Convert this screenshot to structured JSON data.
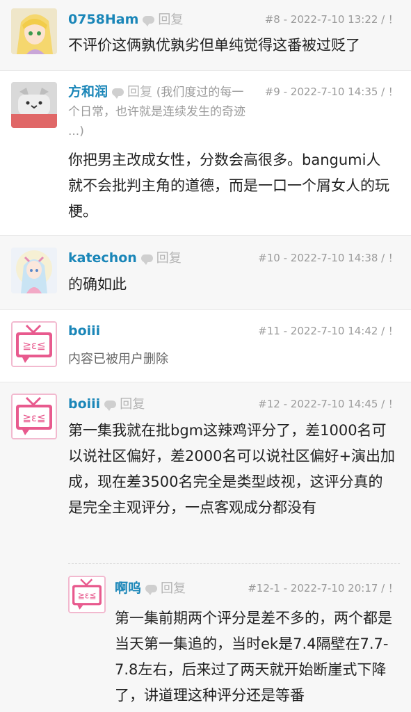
{
  "posts": [
    {
      "username": "0758Ham",
      "reply": "回复",
      "floor": "#8 - 2022-7-10 13:22 / ！",
      "text": "不评价这俩孰优孰劣但单纯觉得这番被过贬了"
    },
    {
      "username": "方和润",
      "reply": "回复",
      "sign_line1": "(我们度过的每一",
      "sign_line2": "个日常，也许就是连续发生的奇迹",
      "sign_line3": "...)",
      "floor": "#9 - 2022-7-10 14:35 / ！",
      "text": "你把男主改成女性，分数会高很多。bangumi人就不会批判主角的道德，而是一口一个屑女人的玩梗。"
    },
    {
      "username": "katechon",
      "reply": "回复",
      "floor": "#10 - 2022-7-10 14:38 / ！",
      "text": "的确如此"
    },
    {
      "username": "boiii",
      "floor": "#11 - 2022-7-10 14:42 / ！",
      "text": "内容已被用户删除"
    },
    {
      "username": "boiii",
      "reply": "回复",
      "floor": "#12 - 2022-7-10 14:45 / ！",
      "text": "第一集我就在批bgm这辣鸡评分了，差1000名可以说社区偏好，差2000名可以说社区偏好+演出加成，现在差3500名完全是类型歧视，这评分真的是完全主观评分，一点客观成分都没有"
    },
    {
      "username": "啊呜",
      "reply": "回复",
      "floor": "#12-1 - 2022-7-10 20:17 / ！",
      "text": "第一集前期两个评分是差不多的，两个都是当天第一集追的，当时ek是7.4隔壁在7.7-7.8左右，后来过了两天就开始断崖式下降了，讲道理这种评分还是等番"
    }
  ],
  "tv_avatar_text": "≧ε≦",
  "colors": {
    "username": "#1a86b8",
    "tv_pink": "#e85a8e"
  }
}
